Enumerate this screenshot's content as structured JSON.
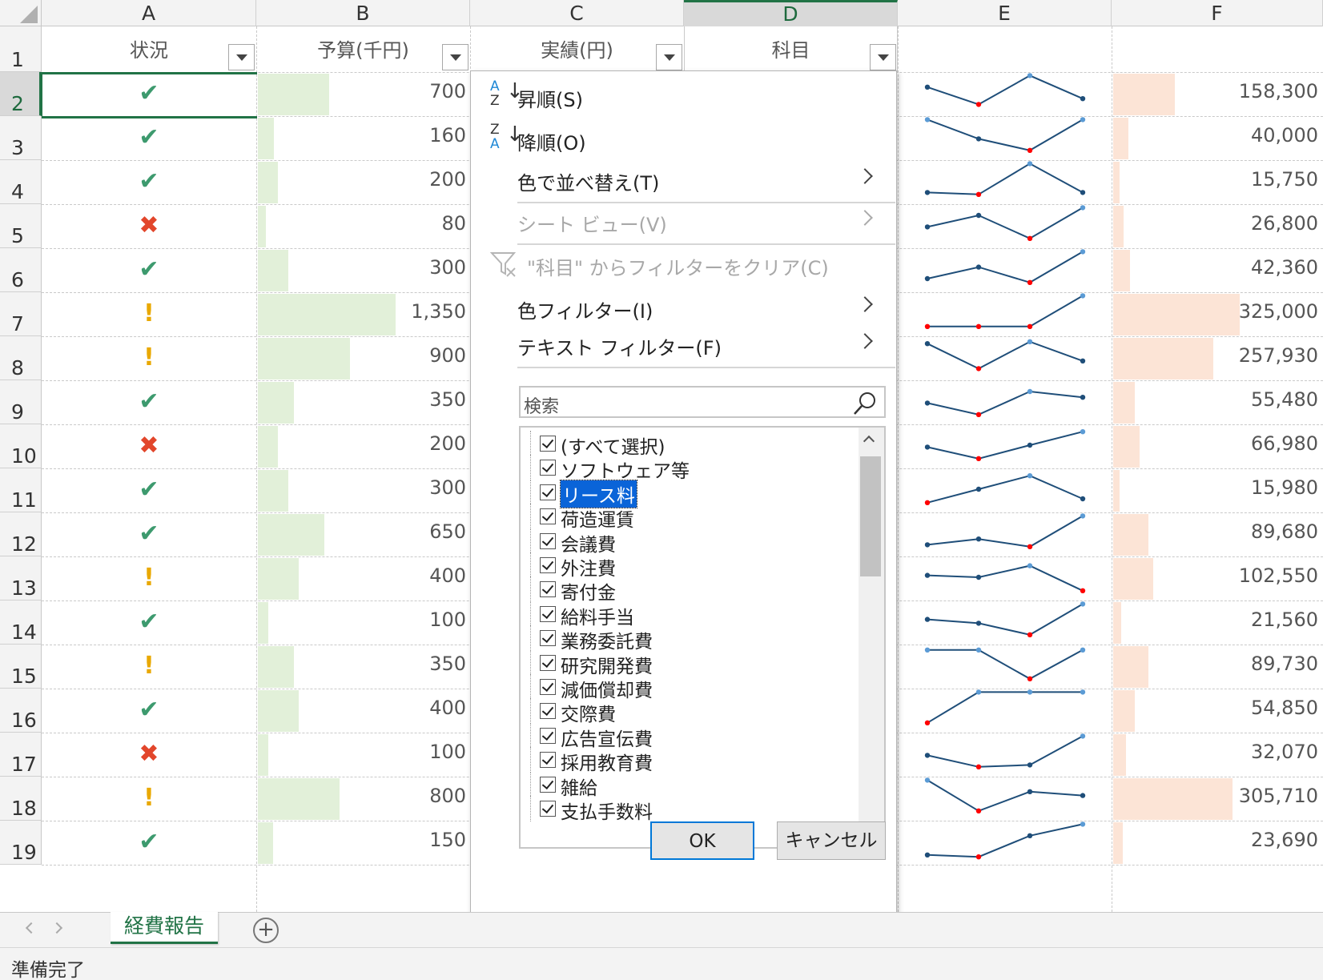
{
  "columns": [
    "A",
    "B",
    "C",
    "D",
    "E",
    "F"
  ],
  "rows": [
    "1",
    "2",
    "3",
    "4",
    "5",
    "6",
    "7",
    "8",
    "9",
    "10",
    "11",
    "12",
    "13",
    "14",
    "15",
    "16",
    "17",
    "18",
    "19"
  ],
  "headers": {
    "a": "状況",
    "b": "予算(千円)",
    "c": "実績(円)",
    "d": "科目"
  },
  "data_rows": [
    {
      "status": "ok",
      "budget": "700",
      "budget_value": 700,
      "actual": "158,300",
      "actual_value": 158300,
      "spark": [
        0.35,
        0.8,
        0.05,
        0.65
      ]
    },
    {
      "status": "ok",
      "budget": "160",
      "budget_value": 160,
      "actual": "40,000",
      "actual_value": 40000,
      "spark": [
        0.05,
        0.55,
        0.85,
        0.05
      ]
    },
    {
      "status": "ok",
      "budget": "200",
      "budget_value": 200,
      "actual": "15,750",
      "actual_value": 15750,
      "spark": [
        0.8,
        0.85,
        0.05,
        0.8
      ]
    },
    {
      "status": "ng",
      "budget": "80",
      "budget_value": 80,
      "actual": "26,800",
      "actual_value": 26800,
      "spark": [
        0.55,
        0.25,
        0.85,
        0.05
      ]
    },
    {
      "status": "ok",
      "budget": "300",
      "budget_value": 300,
      "actual": "42,360",
      "actual_value": 42360,
      "spark": [
        0.75,
        0.45,
        0.85,
        0.05
      ]
    },
    {
      "status": "warn",
      "budget": "1,350",
      "budget_value": 1350,
      "actual": "325,000",
      "actual_value": 325000,
      "spark": [
        0.85,
        0.85,
        0.85,
        0.05
      ]
    },
    {
      "status": "warn",
      "budget": "900",
      "budget_value": 900,
      "actual": "257,930",
      "actual_value": 257930,
      "spark": [
        0.15,
        0.8,
        0.1,
        0.6
      ]
    },
    {
      "status": "ok",
      "budget": "350",
      "budget_value": 350,
      "actual": "55,480",
      "actual_value": 55480,
      "spark": [
        0.55,
        0.85,
        0.25,
        0.4
      ]
    },
    {
      "status": "ng",
      "budget": "200",
      "budget_value": 200,
      "actual": "66,980",
      "actual_value": 66980,
      "spark": [
        0.55,
        0.85,
        0.5,
        0.15
      ]
    },
    {
      "status": "ok",
      "budget": "300",
      "budget_value": 300,
      "actual": "15,980",
      "actual_value": 15980,
      "spark": [
        0.85,
        0.5,
        0.15,
        0.75
      ]
    },
    {
      "status": "ok",
      "budget": "650",
      "budget_value": 650,
      "actual": "89,680",
      "actual_value": 89680,
      "spark": [
        0.8,
        0.65,
        0.85,
        0.05
      ]
    },
    {
      "status": "warn",
      "budget": "400",
      "budget_value": 400,
      "actual": "102,550",
      "actual_value": 102550,
      "spark": [
        0.45,
        0.5,
        0.2,
        0.85
      ]
    },
    {
      "status": "ok",
      "budget": "100",
      "budget_value": 100,
      "actual": "21,560",
      "actual_value": 21560,
      "spark": [
        0.45,
        0.55,
        0.85,
        0.05
      ]
    },
    {
      "status": "warn",
      "budget": "350",
      "budget_value": 350,
      "actual": "89,730",
      "actual_value": 89730,
      "spark": [
        0.1,
        0.1,
        0.85,
        0.1
      ]
    },
    {
      "status": "ok",
      "budget": "400",
      "budget_value": 400,
      "actual": "54,850",
      "actual_value": 54850,
      "spark": [
        0.85,
        0.05,
        0.05,
        0.05
      ]
    },
    {
      "status": "ng",
      "budget": "100",
      "budget_value": 100,
      "actual": "32,070",
      "actual_value": 32070,
      "spark": [
        0.55,
        0.85,
        0.8,
        0.05
      ]
    },
    {
      "status": "warn",
      "budget": "800",
      "budget_value": 800,
      "actual": "305,710",
      "actual_value": 305710,
      "spark": [
        0.05,
        0.85,
        0.35,
        0.45
      ]
    },
    {
      "status": "ok",
      "budget": "150",
      "budget_value": 150,
      "actual": "23,690",
      "actual_value": 23690,
      "spark": [
        0.85,
        0.9,
        0.35,
        0.05
      ]
    }
  ],
  "filter_menu": {
    "sort_asc": "昇順(S)",
    "sort_desc": "降順(O)",
    "sort_by_color": "色で並べ替え(T)",
    "sheet_view": "シート ビュー(V)",
    "clear_filter": "\"科目\" からフィルターをクリア(C)",
    "color_filter": "色フィルター(I)",
    "text_filter": "テキスト フィルター(F)",
    "search_placeholder": "検索",
    "items": [
      "(すべて選択)",
      "ソフトウェア等",
      "リース料",
      "荷造運賃",
      "会議費",
      "外注費",
      "寄付金",
      "給料手当",
      "業務委託費",
      "研究開発費",
      "減価償却費",
      "交際費",
      "広告宣伝費",
      "採用教育費",
      "雑給",
      "支払手数料"
    ],
    "highlighted_item": "リース料",
    "ok": "OK",
    "cancel": "キャンセル"
  },
  "sheet_tab": "経費報告",
  "status_text": "準備完了",
  "colors": {
    "accent": "#217346",
    "budget_bar": "#e2f0d9",
    "actual_bar": "#fce4d6",
    "spark_line": "#1f4e79",
    "spark_high": "#5b9bd5",
    "spark_low": "#ff0000"
  }
}
